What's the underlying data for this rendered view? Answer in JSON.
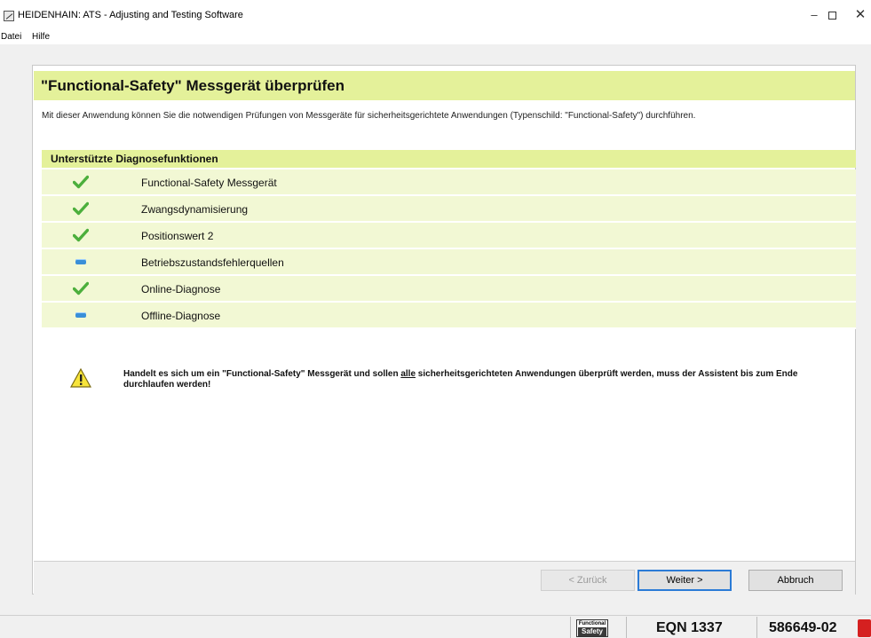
{
  "window": {
    "title": "HEIDENHAIN: ATS - Adjusting and Testing Software",
    "minimize": "–",
    "close": "✕"
  },
  "menu": [
    {
      "label": "Datei"
    },
    {
      "label": "Hilfe"
    }
  ],
  "page": {
    "title": "\"Functional-Safety\" Messgerät überprüfen",
    "description": "Mit dieser Anwendung können Sie die notwendigen Prüfungen von Messgeräte für sicherheitsgerichtete Anwendungen (Typenschild: \"Functional-Safety\") durchführen."
  },
  "diagnostics": {
    "header": "Unterstützte Diagnosefunktionen",
    "items": [
      {
        "label": "Functional-Safety Messgerät",
        "status": "supported"
      },
      {
        "label": "Zwangsdynamisierung",
        "status": "supported"
      },
      {
        "label": "Positionswert 2",
        "status": "supported"
      },
      {
        "label": "Betriebszustandsfehlerquellen",
        "status": "not-supported"
      },
      {
        "label": "Online-Diagnose",
        "status": "supported"
      },
      {
        "label": "Offline-Diagnose",
        "status": "not-supported"
      }
    ]
  },
  "warning": {
    "text_before": "Handelt es sich um ein \"Functional-Safety\" Messgerät und sollen ",
    "text_underlined": "alle",
    "text_after": " sicherheitsgerichteten Anwendungen überprüft werden, muss der Assistent bis zum Ende durchlaufen werden!"
  },
  "buttons": {
    "back": "< Zurück",
    "next": "Weiter >",
    "cancel": "Abbruch"
  },
  "statusbar": {
    "logo_top": "Functional",
    "logo_bottom": "Safety",
    "device_type": "EQN 1337",
    "device_id": "586649-02"
  },
  "colors": {
    "header_band": "#e4f19a",
    "row_background": "#f2f8d4",
    "check_green": "#4caf3c",
    "dash_blue": "#3a8fd8",
    "focus_blue": "#2b7bd6"
  }
}
